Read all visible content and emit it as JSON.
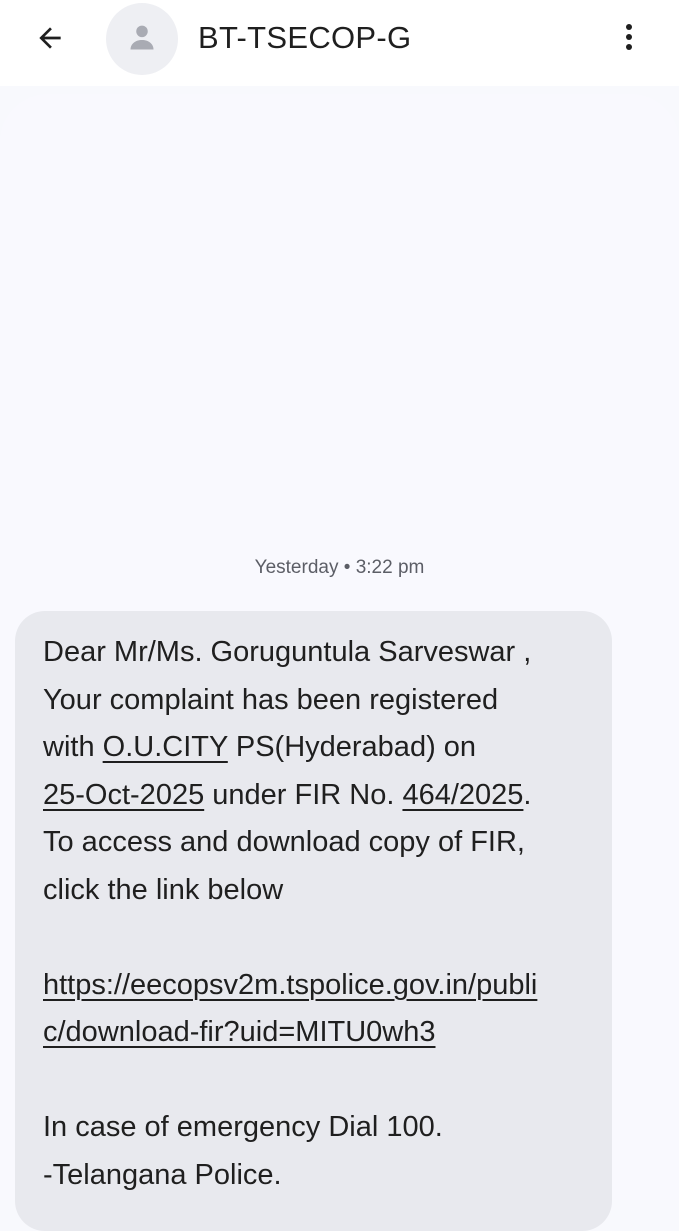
{
  "header": {
    "back_icon": "arrow-back-icon",
    "avatar_icon": "person-icon",
    "contact_name": "BT-TSECOP-G",
    "more_icon": "more-vert-icon"
  },
  "conversation": {
    "timestamp_day": "Yesterday",
    "timestamp_sep": "•",
    "timestamp_time": "3:22 pm",
    "message": {
      "greeting": "Dear Mr/Ms. Goruguntula Sarveswar ,",
      "line2": "Your complaint has been registered",
      "line3_prefix": "with ",
      "station_link": "O.U.CITY",
      "line3_suffix": " PS(Hyderabad) on",
      "date_link": "25-Oct-2025",
      "line4_mid": " under FIR No. ",
      "fir_link": "464/2025",
      "line4_end": ".",
      "line5": "To access and download copy of FIR,",
      "line6": "click the link below",
      "url_part1": "https://eecopsv2m.tspolice.gov.in/publi",
      "url_part2": "c/download-fir?uid=MITU0wh3",
      "emergency": "In case of emergency Dial 100.",
      "signature": "-Telangana Police."
    }
  },
  "colors": {
    "background": "#f8f9fd",
    "bubble": "#e8e9ee",
    "text": "#1f1f1f",
    "muted": "#5c5e66"
  }
}
